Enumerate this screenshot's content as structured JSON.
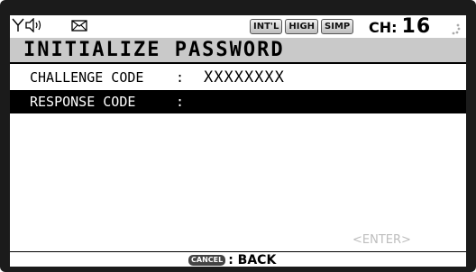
{
  "status": {
    "icons": [
      "antenna-icon",
      "speaker-icon",
      "message-icon",
      "scan-icon"
    ],
    "badges": [
      "INT'L",
      "HIGH",
      "SIMP"
    ],
    "channel_label": "CH:",
    "channel_number": "16"
  },
  "title": "INITIALIZE PASSWORD",
  "fields": [
    {
      "label": "CHALLENGE CODE",
      "colon": ":",
      "value": "XXXXXXXX"
    },
    {
      "label": "RESPONSE CODE",
      "colon": ":",
      "value": ""
    }
  ],
  "enter_hint": "<ENTER>",
  "footer": {
    "cancel_key": "CANCEL",
    "action": ": BACK"
  },
  "colors": {
    "title_bg": "#c9c9c9",
    "selected_bg": "#000000",
    "hint": "#bdbdbd"
  }
}
